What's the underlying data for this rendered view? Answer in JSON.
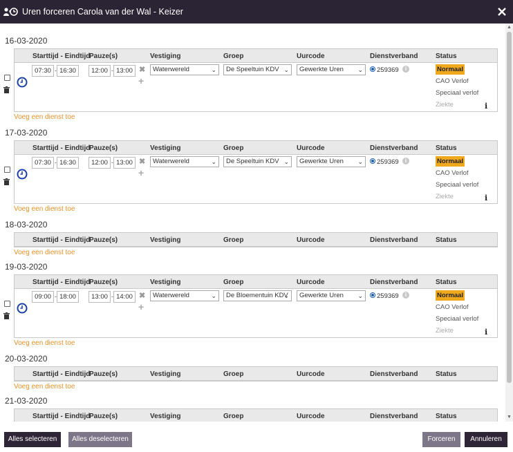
{
  "title": "Uren forceren Carola van der Wal - Keizer",
  "icons": {
    "title": "user-clock-icon",
    "close": "close-icon"
  },
  "columns": {
    "starttijd": "Starttijd - Eindtijd",
    "pauze": "Pauze(s)",
    "vestiging": "Vestiging",
    "groep": "Groep",
    "uurcode": "Uurcode",
    "dienstverband": "Dienstverband",
    "status": "Status"
  },
  "add_link": "Voeg een dienst toe",
  "status_options": [
    "Normaal",
    "CAO Verlof",
    "Speciaal verlof",
    "Ziekte"
  ],
  "days": [
    {
      "date": "16-03-2020",
      "shift": {
        "start": "07:30",
        "end": "16:30",
        "pause_start": "12:00",
        "pause_end": "13:00",
        "vestiging": "Waterwereld",
        "groep": "De Speeltuin KDV",
        "uurcode": "Gewerkte Uren",
        "dienstverband": "259369",
        "status": "Normaal"
      }
    },
    {
      "date": "17-03-2020",
      "shift": {
        "start": "07:30",
        "end": "16:30",
        "pause_start": "12:00",
        "pause_end": "13:00",
        "vestiging": "Waterwereld",
        "groep": "De Speeltuin KDV",
        "uurcode": "Gewerkte Uren",
        "dienstverband": "259369",
        "status": "Normaal"
      }
    },
    {
      "date": "18-03-2020",
      "shift": null
    },
    {
      "date": "19-03-2020",
      "shift": {
        "start": "09:00",
        "end": "18:00",
        "pause_start": "13:00",
        "pause_end": "14:00",
        "vestiging": "Waterwereld",
        "groep": "De Bloementuin KDV",
        "uurcode": "Gewerkte Uren",
        "dienstverband": "259369",
        "status": "Normaal"
      }
    },
    {
      "date": "20-03-2020",
      "shift": null
    },
    {
      "date": "21-03-2020",
      "shift": null
    }
  ],
  "footer": {
    "select_all": "Alles selecteren",
    "deselect_all": "Alles deselecteren",
    "force": "Forceren",
    "cancel": "Annuleren"
  },
  "colors": {
    "titlebar": "#2b2434",
    "accent": "#f0a81c",
    "link": "#e8922a",
    "button_dark": "#2e2536",
    "button_gray": "#7d7688"
  }
}
